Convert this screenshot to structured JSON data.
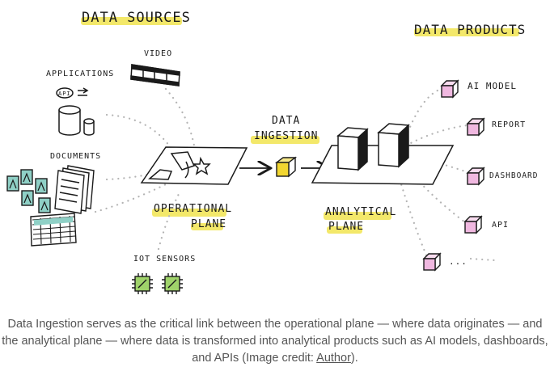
{
  "diagram": {
    "sections": {
      "data_sources": "DATA SOURCES",
      "data_products": "DATA PRODUCTS"
    },
    "sources": {
      "video": "VIDEO",
      "applications": "APPLICATIONS",
      "api_badge": "API",
      "documents": "DOCUMENTS",
      "iot_sensors": "IOT SENSORS"
    },
    "operational_plane": [
      "OPERATIONAL",
      "PLANE"
    ],
    "ingestion": [
      "DATA",
      "INGESTION"
    ],
    "analytical_plane": [
      "ANALYTICAL",
      "PLANE"
    ],
    "products": {
      "ai_model": "AI MODEL",
      "report": "REPORT",
      "dashboard": "DASHBOARD",
      "api": "API",
      "more": "..."
    },
    "colors": {
      "highlight": "#f3e86a",
      "product_cube": "#f0b8e0",
      "ingestion_cube": "#f2d630",
      "chip": "#9fd36a"
    }
  },
  "caption": {
    "text": "Data Ingestion serves as the critical link between the operational plane — where data originates — and the analytical plane — where data is transformed into analytical products such as AI models, dashboards, and APIs (Image credit: ",
    "link": "Author",
    "end": ")."
  }
}
